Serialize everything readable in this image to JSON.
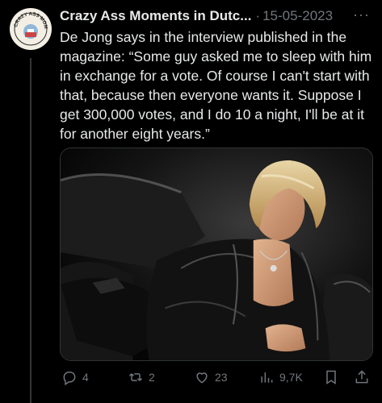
{
  "tweet": {
    "author_name": "Crazy Ass Moments in Dutc...",
    "separator": "·",
    "date": "15-05-2023",
    "more_label": "···",
    "text": "De Jong says in the interview published in the magazine: “Some guy asked me to sleep with him in exchange for a vote. Of course I can't start with that, because then everyone wants it. Suppose I get 300,000 votes, and I do 10 a night, I'll be at it for another eight years.”",
    "avatar_text": "CRAZY ASS MOMENTS"
  },
  "actions": {
    "replies": "4",
    "reposts": "2",
    "likes": "23",
    "views": "9,7K"
  },
  "icons": {
    "reply": "reply-icon",
    "repost": "repost-icon",
    "like": "heart-icon",
    "views": "views-icon",
    "bookmark": "bookmark-icon",
    "share": "share-icon"
  },
  "colors": {
    "background": "#000000",
    "text": "#e7e9ea",
    "muted": "#71767b",
    "divider": "#333639"
  }
}
